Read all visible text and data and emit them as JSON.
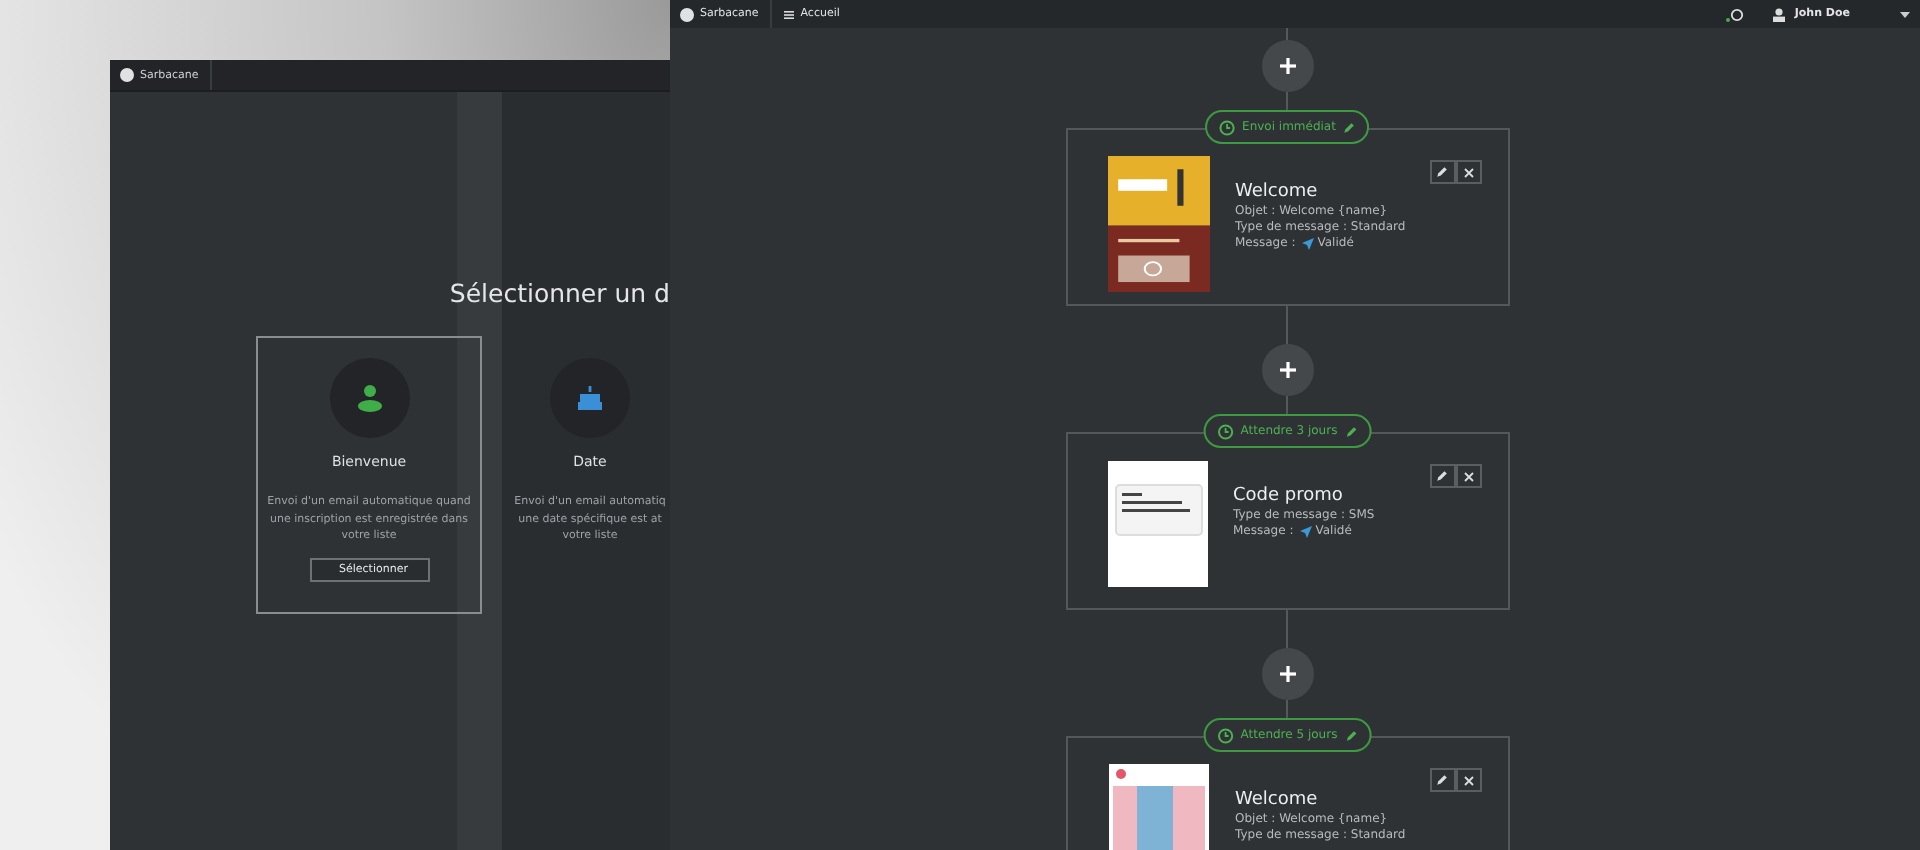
{
  "back_window": {
    "logo": "Sarbacane",
    "heading": "Sélectionner un d",
    "cards": [
      {
        "kind": "welcome",
        "title": "Bienvenue",
        "description": "Envoi d'un email automatique quand\nune inscription est enregistrée dans\nvotre liste",
        "button": "Sélectionner",
        "selected": true
      },
      {
        "kind": "date",
        "title": "Date",
        "description": "Envoi d'un email automatiq\nune date spécifique est at\nvotre liste",
        "selected": false
      }
    ]
  },
  "topbar": {
    "logo": "Sarbacane",
    "menu": "Accueil",
    "user": "John Doe"
  },
  "steps": [
    {
      "trigger": "Envoi immédiat",
      "kind": "email-banner",
      "title": "Welcome",
      "lines": [
        {
          "kind": "text",
          "text": "Objet : Welcome {name}"
        },
        {
          "kind": "text",
          "text": "Type de message : Standard"
        },
        {
          "kind": "status",
          "label": "Message :",
          "status": "Validé"
        }
      ]
    },
    {
      "trigger": "Attendre 3 jours",
      "kind": "sms",
      "title": "Code promo",
      "lines": [
        {
          "kind": "text",
          "text": "Type de message : SMS"
        },
        {
          "kind": "status",
          "label": "Message :",
          "status": "Validé"
        }
      ]
    },
    {
      "trigger": "Attendre 5 jours",
      "kind": "email-photo",
      "title": "Welcome",
      "lines": [
        {
          "kind": "text",
          "text": "Objet : Welcome {name}"
        },
        {
          "kind": "text",
          "text": "Type de message : Standard"
        }
      ]
    }
  ]
}
